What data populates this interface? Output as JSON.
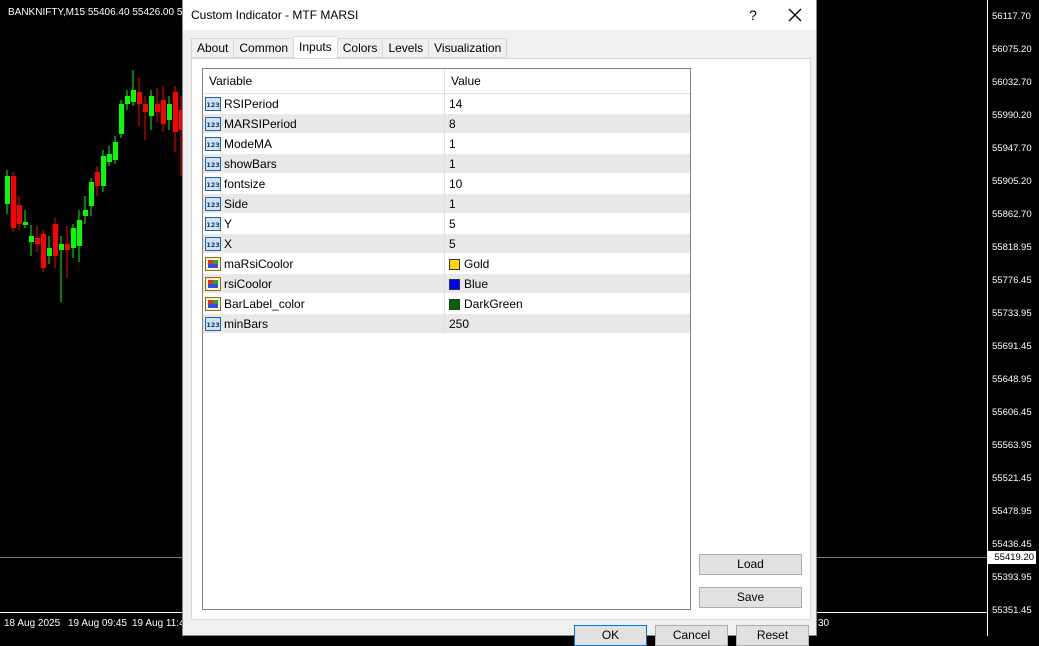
{
  "chart": {
    "title": "BANKNIFTY,M15  55406.40 55426.00 55",
    "price_labels": [
      "56117.70",
      "56075.20",
      "56032.70",
      "55990.20",
      "55947.70",
      "55905.20",
      "55862.70",
      "55818.95",
      "55776.45",
      "55733.95",
      "55691.45",
      "55648.95",
      "55606.45",
      "55563.95",
      "55521.45",
      "55478.95",
      "55436.45",
      "55393.95",
      "55351.45"
    ],
    "current_price": "55419.20",
    "time_labels": [
      "18 Aug 2025",
      "19 Aug 09:45",
      "19 Aug 11:4",
      "30"
    ],
    "colors": {
      "bull": "#00ff00",
      "bear": "#ff0000",
      "background": "#000000"
    }
  },
  "dialog": {
    "title": "Custom Indicator - MTF MARSI",
    "help_label": "?",
    "close_icon": "close-icon",
    "tabs": [
      "About",
      "Common",
      "Inputs",
      "Colors",
      "Levels",
      "Visualization"
    ],
    "active_tab": "Inputs",
    "grid": {
      "headers": {
        "variable": "Variable",
        "value": "Value"
      },
      "rows": [
        {
          "name": "RSIPeriod",
          "value": "14",
          "type": "int"
        },
        {
          "name": "MARSIPeriod",
          "value": "8",
          "type": "int"
        },
        {
          "name": "ModeMA",
          "value": "1",
          "type": "int"
        },
        {
          "name": "showBars",
          "value": "1",
          "type": "int"
        },
        {
          "name": "fontsize",
          "value": "10",
          "type": "int"
        },
        {
          "name": "Side",
          "value": "1",
          "type": "int"
        },
        {
          "name": "Y",
          "value": "5",
          "type": "int"
        },
        {
          "name": "X",
          "value": "5",
          "type": "int"
        },
        {
          "name": "maRsiCoolor",
          "value": "Gold",
          "type": "color",
          "swatch": "#ffd700"
        },
        {
          "name": "rsiCoolor",
          "value": "Blue",
          "type": "color",
          "swatch": "#0000ff"
        },
        {
          "name": "BarLabel_color",
          "value": "DarkGreen",
          "type": "color",
          "swatch": "#006400"
        },
        {
          "name": "minBars",
          "value": "250",
          "type": "int"
        }
      ]
    },
    "buttons": {
      "load": "Load",
      "save": "Save",
      "ok": "OK",
      "cancel": "Cancel",
      "reset": "Reset"
    }
  }
}
